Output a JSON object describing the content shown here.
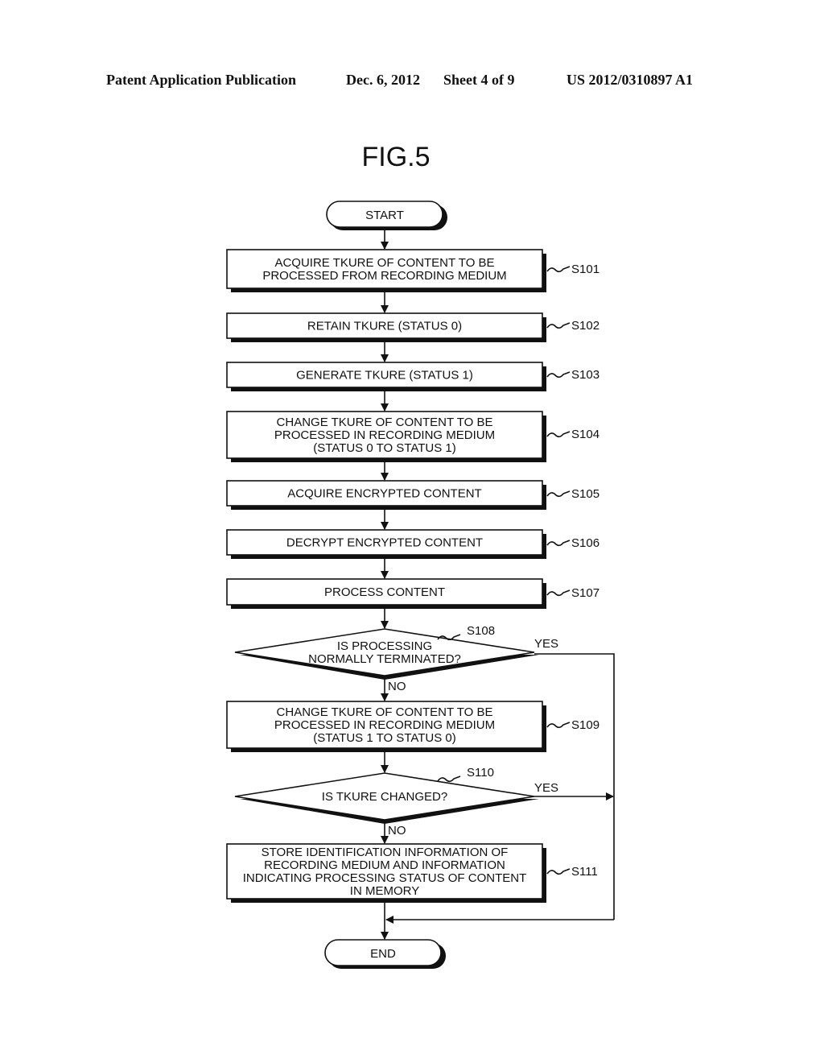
{
  "header": {
    "publication": "Patent Application Publication",
    "date": "Dec. 6, 2012",
    "sheet": "Sheet 4 of 9",
    "number": "US 2012/0310897 A1"
  },
  "figure": {
    "title": "FIG.5"
  },
  "flowchart": {
    "start": "START",
    "end": "END",
    "steps": [
      {
        "id": "S101",
        "lines": [
          "ACQUIRE TKURE OF CONTENT TO BE",
          "PROCESSED FROM RECORDING MEDIUM"
        ]
      },
      {
        "id": "S102",
        "lines": [
          "RETAIN TKURE (STATUS 0)"
        ]
      },
      {
        "id": "S103",
        "lines": [
          "GENERATE TKURE (STATUS 1)"
        ]
      },
      {
        "id": "S104",
        "lines": [
          "CHANGE TKURE OF CONTENT TO BE",
          "PROCESSED IN RECORDING MEDIUM",
          "(STATUS 0 TO STATUS 1)"
        ]
      },
      {
        "id": "S105",
        "lines": [
          "ACQUIRE ENCRYPTED CONTENT"
        ]
      },
      {
        "id": "S106",
        "lines": [
          "DECRYPT ENCRYPTED CONTENT"
        ]
      },
      {
        "id": "S107",
        "lines": [
          "PROCESS CONTENT"
        ]
      },
      {
        "id": "S108",
        "lines": [
          "IS PROCESSING",
          "NORMALLY TERMINATED?"
        ],
        "yes": "YES",
        "no": "NO"
      },
      {
        "id": "S109",
        "lines": [
          "CHANGE TKURE OF CONTENT TO BE",
          "PROCESSED IN RECORDING MEDIUM",
          "(STATUS 1 TO STATUS 0)"
        ]
      },
      {
        "id": "S110",
        "lines": [
          "IS TKURE CHANGED?"
        ],
        "yes": "YES",
        "no": "NO"
      },
      {
        "id": "S111",
        "lines": [
          "STORE IDENTIFICATION INFORMATION OF",
          "RECORDING MEDIUM AND INFORMATION",
          "INDICATING PROCESSING STATUS OF CONTENT",
          "IN MEMORY"
        ]
      }
    ]
  }
}
